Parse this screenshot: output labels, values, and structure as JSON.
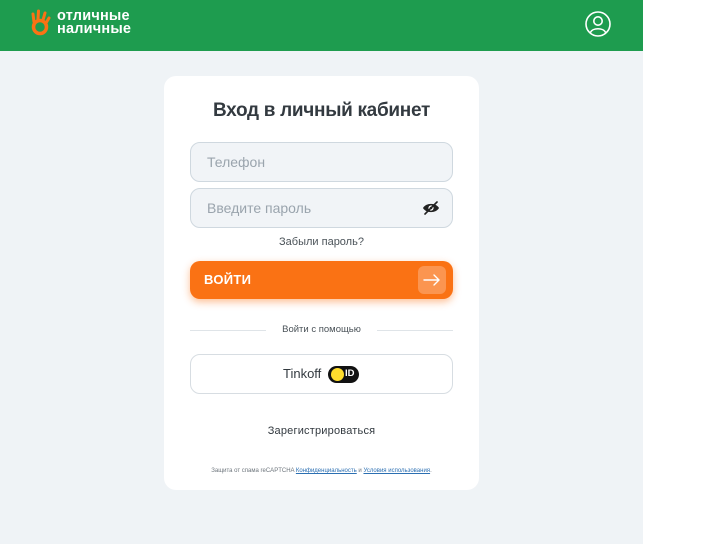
{
  "header": {
    "logo_line1": "отличные",
    "logo_line2": "наличные",
    "brand_color": "#1e9c4f",
    "profile_icon": "user-circle-icon"
  },
  "login_card": {
    "title": "Вход в личный кабинет",
    "phone_placeholder": "Телефон",
    "password_placeholder": "Введите пароль",
    "password_toggle_icon": "eye-icon",
    "forgot_password": "Забыли пароль?",
    "login_button": "ВОЙТИ",
    "login_button_color": "#fa7214",
    "login_arrow_icon": "arrow-right-icon",
    "divider_text": "Войти с помощью",
    "tinkoff_label": "Tinkoff",
    "tinkoff_id_badge": "ID",
    "register": "Зарегистрироваться",
    "footer_prefix": "Защита от спама reCAPTCHA",
    "footer_privacy": "Конфиденциальность",
    "footer_and": "и",
    "footer_terms": "Условия использования",
    "footer_suffix": "."
  }
}
